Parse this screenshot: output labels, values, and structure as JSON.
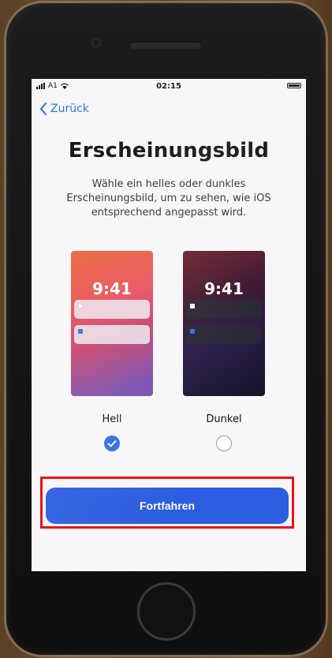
{
  "status_bar": {
    "carrier": "A1",
    "time": "02:15"
  },
  "nav": {
    "back_label": "Zurück"
  },
  "page": {
    "title": "Erscheinungsbild",
    "subtitle": "Wähle ein helles oder dunkles Erscheinungsbild, um zu sehen, wie iOS entsprechend angepasst wird."
  },
  "options": [
    {
      "label": "Hell",
      "preview_time": "9:41",
      "selected": true
    },
    {
      "label": "Dunkel",
      "preview_time": "9:41",
      "selected": false
    }
  ],
  "actions": {
    "continue_label": "Fortfahren"
  },
  "colors": {
    "accent": "#2f6fe0",
    "button": "#2c5de0",
    "highlight": "#e8141a"
  },
  "icons": {
    "back": "chevron-left-icon",
    "selected": "checkmark-icon",
    "wifi": "wifi-icon",
    "battery": "battery-icon",
    "signal": "signal-icon"
  }
}
